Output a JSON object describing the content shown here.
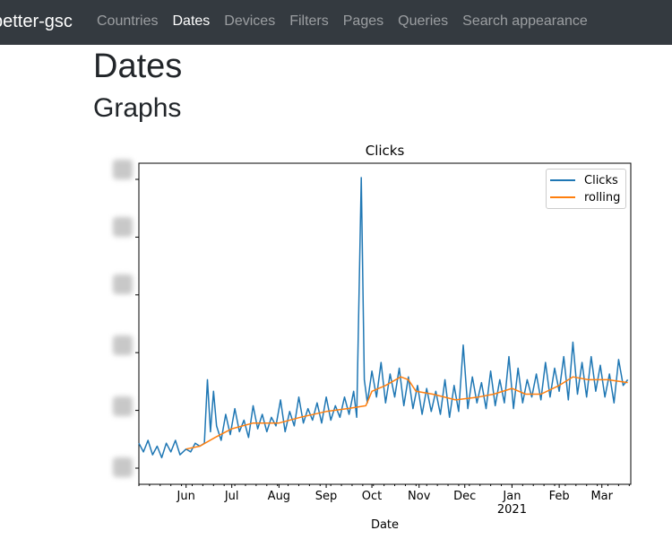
{
  "navbar": {
    "brand": "better-gsc",
    "links": [
      {
        "label": "Countries",
        "active": false
      },
      {
        "label": "Dates",
        "active": true
      },
      {
        "label": "Devices",
        "active": false
      },
      {
        "label": "Filters",
        "active": false
      },
      {
        "label": "Pages",
        "active": false
      },
      {
        "label": "Queries",
        "active": false
      },
      {
        "label": "Search appearance",
        "active": false
      }
    ]
  },
  "page": {
    "title": "Dates",
    "section_title": "Graphs"
  },
  "colors": {
    "navbar_bg": "#343a40",
    "series_clicks": "#1f77b4",
    "series_rolling": "#ff7f0e"
  },
  "chart_data": {
    "type": "line",
    "title": "Clicks",
    "xlabel": "Date",
    "ylabel": "",
    "x_range": [
      "2020-05-01",
      "2021-03-20"
    ],
    "x_ticks": [
      {
        "date": "2020-06-01",
        "label": "Jun"
      },
      {
        "date": "2020-07-01",
        "label": "Jul"
      },
      {
        "date": "2020-08-01",
        "label": "Aug"
      },
      {
        "date": "2020-09-01",
        "label": "Sep"
      },
      {
        "date": "2020-10-01",
        "label": "Oct"
      },
      {
        "date": "2020-11-01",
        "label": "Nov"
      },
      {
        "date": "2020-12-01",
        "label": "Dec"
      },
      {
        "date": "2021-01-01",
        "label": "Jan",
        "sublabel": "2021"
      },
      {
        "date": "2021-02-01",
        "label": "Feb"
      },
      {
        "date": "2021-03-01",
        "label": "Mar"
      }
    ],
    "y_tick_labels_visible": false,
    "ylim": [
      0,
      100
    ],
    "legend": {
      "position": "upper right",
      "entries": [
        "Clicks",
        "rolling"
      ]
    },
    "grid": false,
    "series": [
      {
        "name": "Clicks",
        "points": [
          [
            "2020-05-01",
            8
          ],
          [
            "2020-05-04",
            5
          ],
          [
            "2020-05-07",
            9
          ],
          [
            "2020-05-10",
            4
          ],
          [
            "2020-05-13",
            7
          ],
          [
            "2020-05-16",
            3
          ],
          [
            "2020-05-19",
            8
          ],
          [
            "2020-05-22",
            5
          ],
          [
            "2020-05-25",
            9
          ],
          [
            "2020-05-28",
            4
          ],
          [
            "2020-06-01",
            6
          ],
          [
            "2020-06-04",
            5
          ],
          [
            "2020-06-07",
            8
          ],
          [
            "2020-06-10",
            7
          ],
          [
            "2020-06-13",
            8
          ],
          [
            "2020-06-15",
            30
          ],
          [
            "2020-06-17",
            12
          ],
          [
            "2020-06-19",
            26
          ],
          [
            "2020-06-21",
            14
          ],
          [
            "2020-06-24",
            9
          ],
          [
            "2020-06-27",
            18
          ],
          [
            "2020-06-30",
            11
          ],
          [
            "2020-07-03",
            20
          ],
          [
            "2020-07-06",
            12
          ],
          [
            "2020-07-09",
            16
          ],
          [
            "2020-07-12",
            10
          ],
          [
            "2020-07-15",
            21
          ],
          [
            "2020-07-18",
            13
          ],
          [
            "2020-07-21",
            18
          ],
          [
            "2020-07-24",
            12
          ],
          [
            "2020-07-27",
            17
          ],
          [
            "2020-07-30",
            14
          ],
          [
            "2020-08-02",
            23
          ],
          [
            "2020-08-05",
            12
          ],
          [
            "2020-08-08",
            19
          ],
          [
            "2020-08-11",
            14
          ],
          [
            "2020-08-14",
            24
          ],
          [
            "2020-08-17",
            15
          ],
          [
            "2020-08-20",
            20
          ],
          [
            "2020-08-23",
            16
          ],
          [
            "2020-08-26",
            22
          ],
          [
            "2020-08-29",
            15
          ],
          [
            "2020-09-01",
            24
          ],
          [
            "2020-09-04",
            16
          ],
          [
            "2020-09-07",
            21
          ],
          [
            "2020-09-10",
            17
          ],
          [
            "2020-09-13",
            24
          ],
          [
            "2020-09-16",
            18
          ],
          [
            "2020-09-19",
            26
          ],
          [
            "2020-09-21",
            17
          ],
          [
            "2020-09-24",
            100
          ],
          [
            "2020-09-26",
            30
          ],
          [
            "2020-09-28",
            22
          ],
          [
            "2020-10-01",
            33
          ],
          [
            "2020-10-04",
            24
          ],
          [
            "2020-10-07",
            36
          ],
          [
            "2020-10-10",
            22
          ],
          [
            "2020-10-13",
            32
          ],
          [
            "2020-10-16",
            24
          ],
          [
            "2020-10-19",
            34
          ],
          [
            "2020-10-22",
            21
          ],
          [
            "2020-10-25",
            31
          ],
          [
            "2020-10-28",
            20
          ],
          [
            "2020-10-31",
            28
          ],
          [
            "2020-11-03",
            18
          ],
          [
            "2020-11-06",
            27
          ],
          [
            "2020-11-09",
            19
          ],
          [
            "2020-11-12",
            26
          ],
          [
            "2020-11-15",
            18
          ],
          [
            "2020-11-18",
            30
          ],
          [
            "2020-11-21",
            17
          ],
          [
            "2020-11-24",
            28
          ],
          [
            "2020-11-27",
            19
          ],
          [
            "2020-11-30",
            42
          ],
          [
            "2020-12-03",
            20
          ],
          [
            "2020-12-06",
            31
          ],
          [
            "2020-12-09",
            22
          ],
          [
            "2020-12-12",
            29
          ],
          [
            "2020-12-15",
            20
          ],
          [
            "2020-12-18",
            33
          ],
          [
            "2020-12-21",
            21
          ],
          [
            "2020-12-24",
            30
          ],
          [
            "2020-12-27",
            22
          ],
          [
            "2020-12-30",
            38
          ],
          [
            "2021-01-02",
            20
          ],
          [
            "2021-01-05",
            34
          ],
          [
            "2021-01-08",
            22
          ],
          [
            "2021-01-11",
            30
          ],
          [
            "2021-01-14",
            24
          ],
          [
            "2021-01-17",
            32
          ],
          [
            "2021-01-20",
            23
          ],
          [
            "2021-01-23",
            36
          ],
          [
            "2021-01-26",
            24
          ],
          [
            "2021-01-29",
            34
          ],
          [
            "2021-02-01",
            26
          ],
          [
            "2021-02-04",
            38
          ],
          [
            "2021-02-07",
            23
          ],
          [
            "2021-02-10",
            43
          ],
          [
            "2021-02-13",
            25
          ],
          [
            "2021-02-16",
            36
          ],
          [
            "2021-02-19",
            24
          ],
          [
            "2021-02-22",
            38
          ],
          [
            "2021-02-25",
            26
          ],
          [
            "2021-02-28",
            35
          ],
          [
            "2021-03-03",
            24
          ],
          [
            "2021-03-06",
            32
          ],
          [
            "2021-03-09",
            22
          ],
          [
            "2021-03-12",
            37
          ],
          [
            "2021-03-15",
            28
          ],
          [
            "2021-03-18",
            30
          ]
        ]
      },
      {
        "name": "rolling",
        "points": [
          [
            "2020-06-01",
            6
          ],
          [
            "2020-06-10",
            7
          ],
          [
            "2020-06-20",
            10
          ],
          [
            "2020-07-01",
            13
          ],
          [
            "2020-07-15",
            15
          ],
          [
            "2020-08-01",
            15
          ],
          [
            "2020-08-15",
            17
          ],
          [
            "2020-09-01",
            19
          ],
          [
            "2020-09-15",
            20
          ],
          [
            "2020-09-27",
            21
          ],
          [
            "2020-10-01",
            26
          ],
          [
            "2020-10-10",
            28
          ],
          [
            "2020-10-20",
            31
          ],
          [
            "2020-10-25",
            30
          ],
          [
            "2020-10-30",
            26
          ],
          [
            "2020-11-10",
            25
          ],
          [
            "2020-11-25",
            23
          ],
          [
            "2020-12-10",
            24
          ],
          [
            "2020-12-20",
            25
          ],
          [
            "2021-01-01",
            27
          ],
          [
            "2021-01-10",
            25
          ],
          [
            "2021-01-20",
            25
          ],
          [
            "2021-02-01",
            28
          ],
          [
            "2021-02-10",
            31
          ],
          [
            "2021-02-20",
            30
          ],
          [
            "2021-03-05",
            30
          ],
          [
            "2021-03-18",
            29
          ]
        ]
      }
    ]
  }
}
